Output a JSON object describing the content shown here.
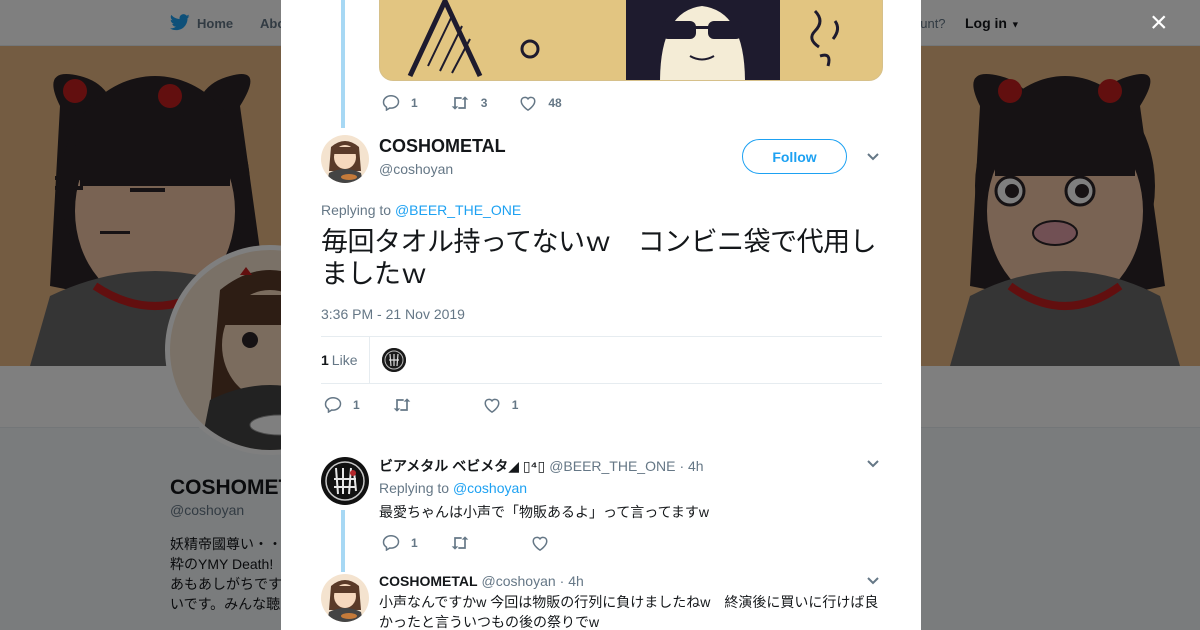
{
  "background": {
    "nav": {
      "home": "Home",
      "about": "Abo",
      "account_prompt": "ccount?",
      "login": "Log in"
    },
    "profile": {
      "name": "COSHOMET",
      "handle": "@coshoyan",
      "bio_lines": [
        "妖精帝國尊い・・",
        "粋のYMY Death! ",
        "あもあしがちです",
        "いです。みんな聴"
      ]
    }
  },
  "modal": {
    "close_label": "×",
    "parent_actions": {
      "replies": "1",
      "retweets": "3",
      "likes": "48"
    },
    "main_tweet": {
      "name": "COSHOMETAL",
      "handle": "@coshoyan",
      "follow_label": "Follow",
      "replying_prefix": "Replying to",
      "replying_to": "@BEER_THE_ONE",
      "text": "毎回タオル持ってないｗ　コンビニ袋で代用しましたｗ",
      "timestamp": "3:36 PM - 21 Nov 2019",
      "like_count": "1",
      "like_label": "Like",
      "actions": {
        "replies": "1",
        "retweets": "",
        "likes": "1"
      }
    },
    "replies": [
      {
        "name": "ビアメタル ベビメタ◢ ▯⁴▯",
        "handle": "@BEER_THE_ONE",
        "time": "· 4h",
        "replying_prefix": "Replying to",
        "replying_to": "@coshoyan",
        "text": "最愛ちゃんは小声で「物販あるよ」って言ってますw",
        "actions": {
          "replies": "1",
          "retweets": "",
          "likes": ""
        }
      },
      {
        "name": "COSHOMETAL",
        "handle": "@coshoyan",
        "time": "· 4h",
        "text": "小声なんですかw  今回は物販の行列に負けましたねw　終演後に買いに行けば良かったと言ういつもの後の祭りでw"
      }
    ]
  },
  "colors": {
    "accent": "#1da1f2",
    "thread_line": "#a7d8f4",
    "muted": "#657786"
  }
}
